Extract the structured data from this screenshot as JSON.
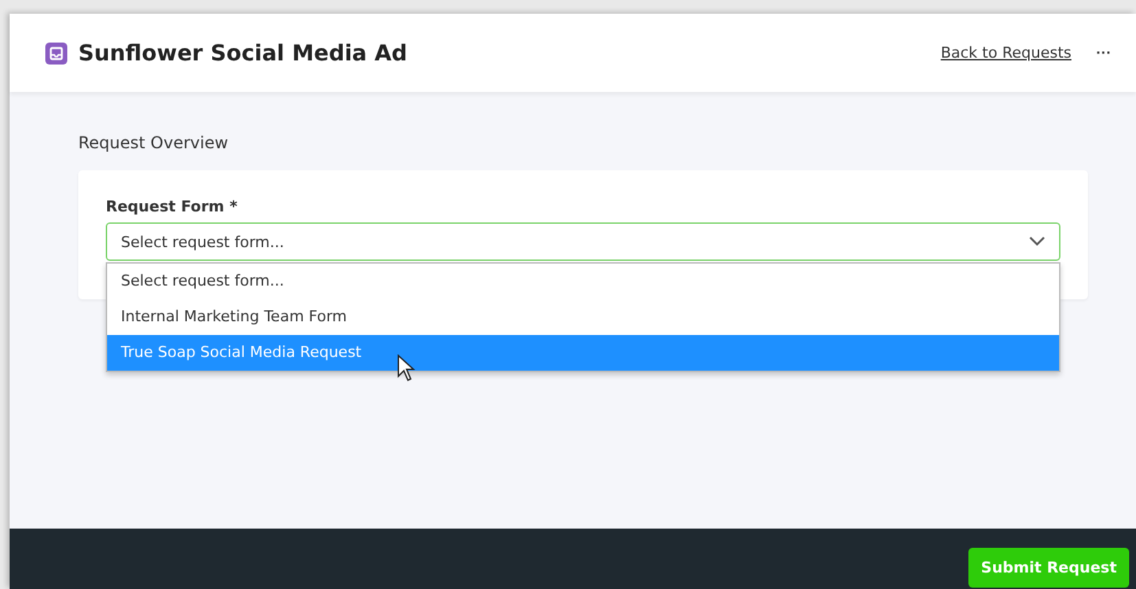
{
  "header": {
    "title": "Sunflower Social Media Ad",
    "back_link": "Back to Requests",
    "more": "···"
  },
  "section_title": "Request Overview",
  "form": {
    "label": "Request Form *",
    "select": {
      "value": "Select request form...",
      "expanded": true
    },
    "options": [
      {
        "label": "Select request form...",
        "selected": false
      },
      {
        "label": "Internal Marketing Team Form",
        "selected": false
      },
      {
        "label": "True Soap Social Media Request",
        "selected": true
      }
    ]
  },
  "footer": {
    "submit": "Submit Request"
  }
}
